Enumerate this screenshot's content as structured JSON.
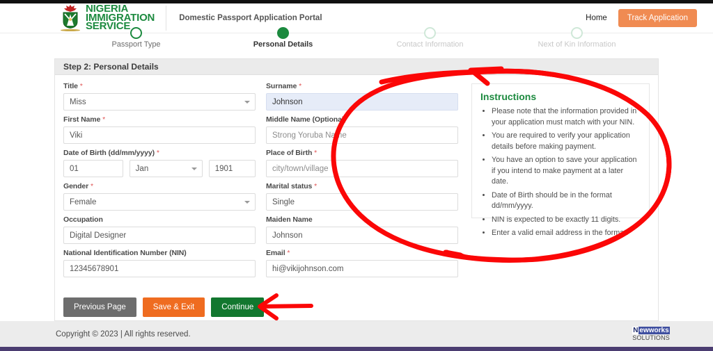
{
  "header": {
    "brand_line1": "NIGERIA",
    "brand_line2": "IMMIGRATION",
    "brand_line3": "SERVICE",
    "portal_title": "Domestic Passport Application Portal",
    "nav_home": "Home",
    "track_button": "Track Application",
    "brand_color": "#1c8a3f",
    "track_button_color": "#f08b52"
  },
  "stepper": {
    "steps": [
      {
        "label": "Passport Type",
        "state": "done"
      },
      {
        "label": "Personal Details",
        "state": "active"
      },
      {
        "label": "Contact Information",
        "state": "future"
      },
      {
        "label": "Next of Kin Information",
        "state": "future"
      }
    ]
  },
  "card": {
    "title": "Step 2: Personal Details",
    "fields": {
      "title": {
        "label": "Title",
        "required": "*",
        "value": "Miss",
        "type": "select"
      },
      "surname": {
        "label": "Surname",
        "required": "*",
        "value": "Johnson",
        "type": "text"
      },
      "first_name": {
        "label": "First Name",
        "required": "*",
        "value": "Viki",
        "type": "text"
      },
      "middle_name": {
        "label": "Middle Name (Optional)",
        "required": "",
        "placeholder": "Strong Yoruba Name",
        "type": "text"
      },
      "dob": {
        "label": "Date of Birth (dd/mm/yyyy)",
        "required": "*",
        "day": "01",
        "month": "Jan",
        "year": "1901"
      },
      "place_of_birth": {
        "label": "Place of Birth",
        "required": "*",
        "placeholder": "city/town/village",
        "type": "text"
      },
      "gender": {
        "label": "Gender",
        "required": "*",
        "value": "Female",
        "type": "select"
      },
      "marital_status": {
        "label": "Marital status",
        "required": "*",
        "value": "Single",
        "type": "text"
      },
      "occupation": {
        "label": "Occupation",
        "required": "",
        "value": "Digital Designer",
        "type": "text"
      },
      "maiden_name": {
        "label": "Maiden Name",
        "required": "",
        "value": "Johnson",
        "type": "text"
      },
      "nin": {
        "label": "National Identification Number (NIN)",
        "required": "",
        "value": "12345678901",
        "type": "text"
      },
      "email": {
        "label": "Email",
        "required": "*",
        "value": "hi@vikijohnson.com",
        "type": "text"
      }
    },
    "instructions": {
      "heading": "Instructions",
      "items": [
        "Please note that the information provided in your application must match with your NIN.",
        "You are required to verify your application details before making payment.",
        "You have an option to save your application if you intend to make payment at a later date.",
        "Date of Birth should be in the format dd/mm/yyyy.",
        "NIN is expected to be exactly 11 digits.",
        "Enter a valid email address in the format."
      ]
    },
    "actions": {
      "previous": "Previous Page",
      "save_exit": "Save & Exit",
      "continue": "Continue",
      "previous_color": "#6d6d6d",
      "save_color": "#ef6c20",
      "continue_color": "#12772f"
    }
  },
  "footer": {
    "copyright": "Copyright © 2023 | All rights reserved.",
    "vendor_n": "N",
    "vendor_rest": "ewworks",
    "vendor_sub": "SOLUTIONS"
  },
  "annotations": {
    "circle_color": "#fb0707",
    "arrow_color": "#fb0707"
  }
}
